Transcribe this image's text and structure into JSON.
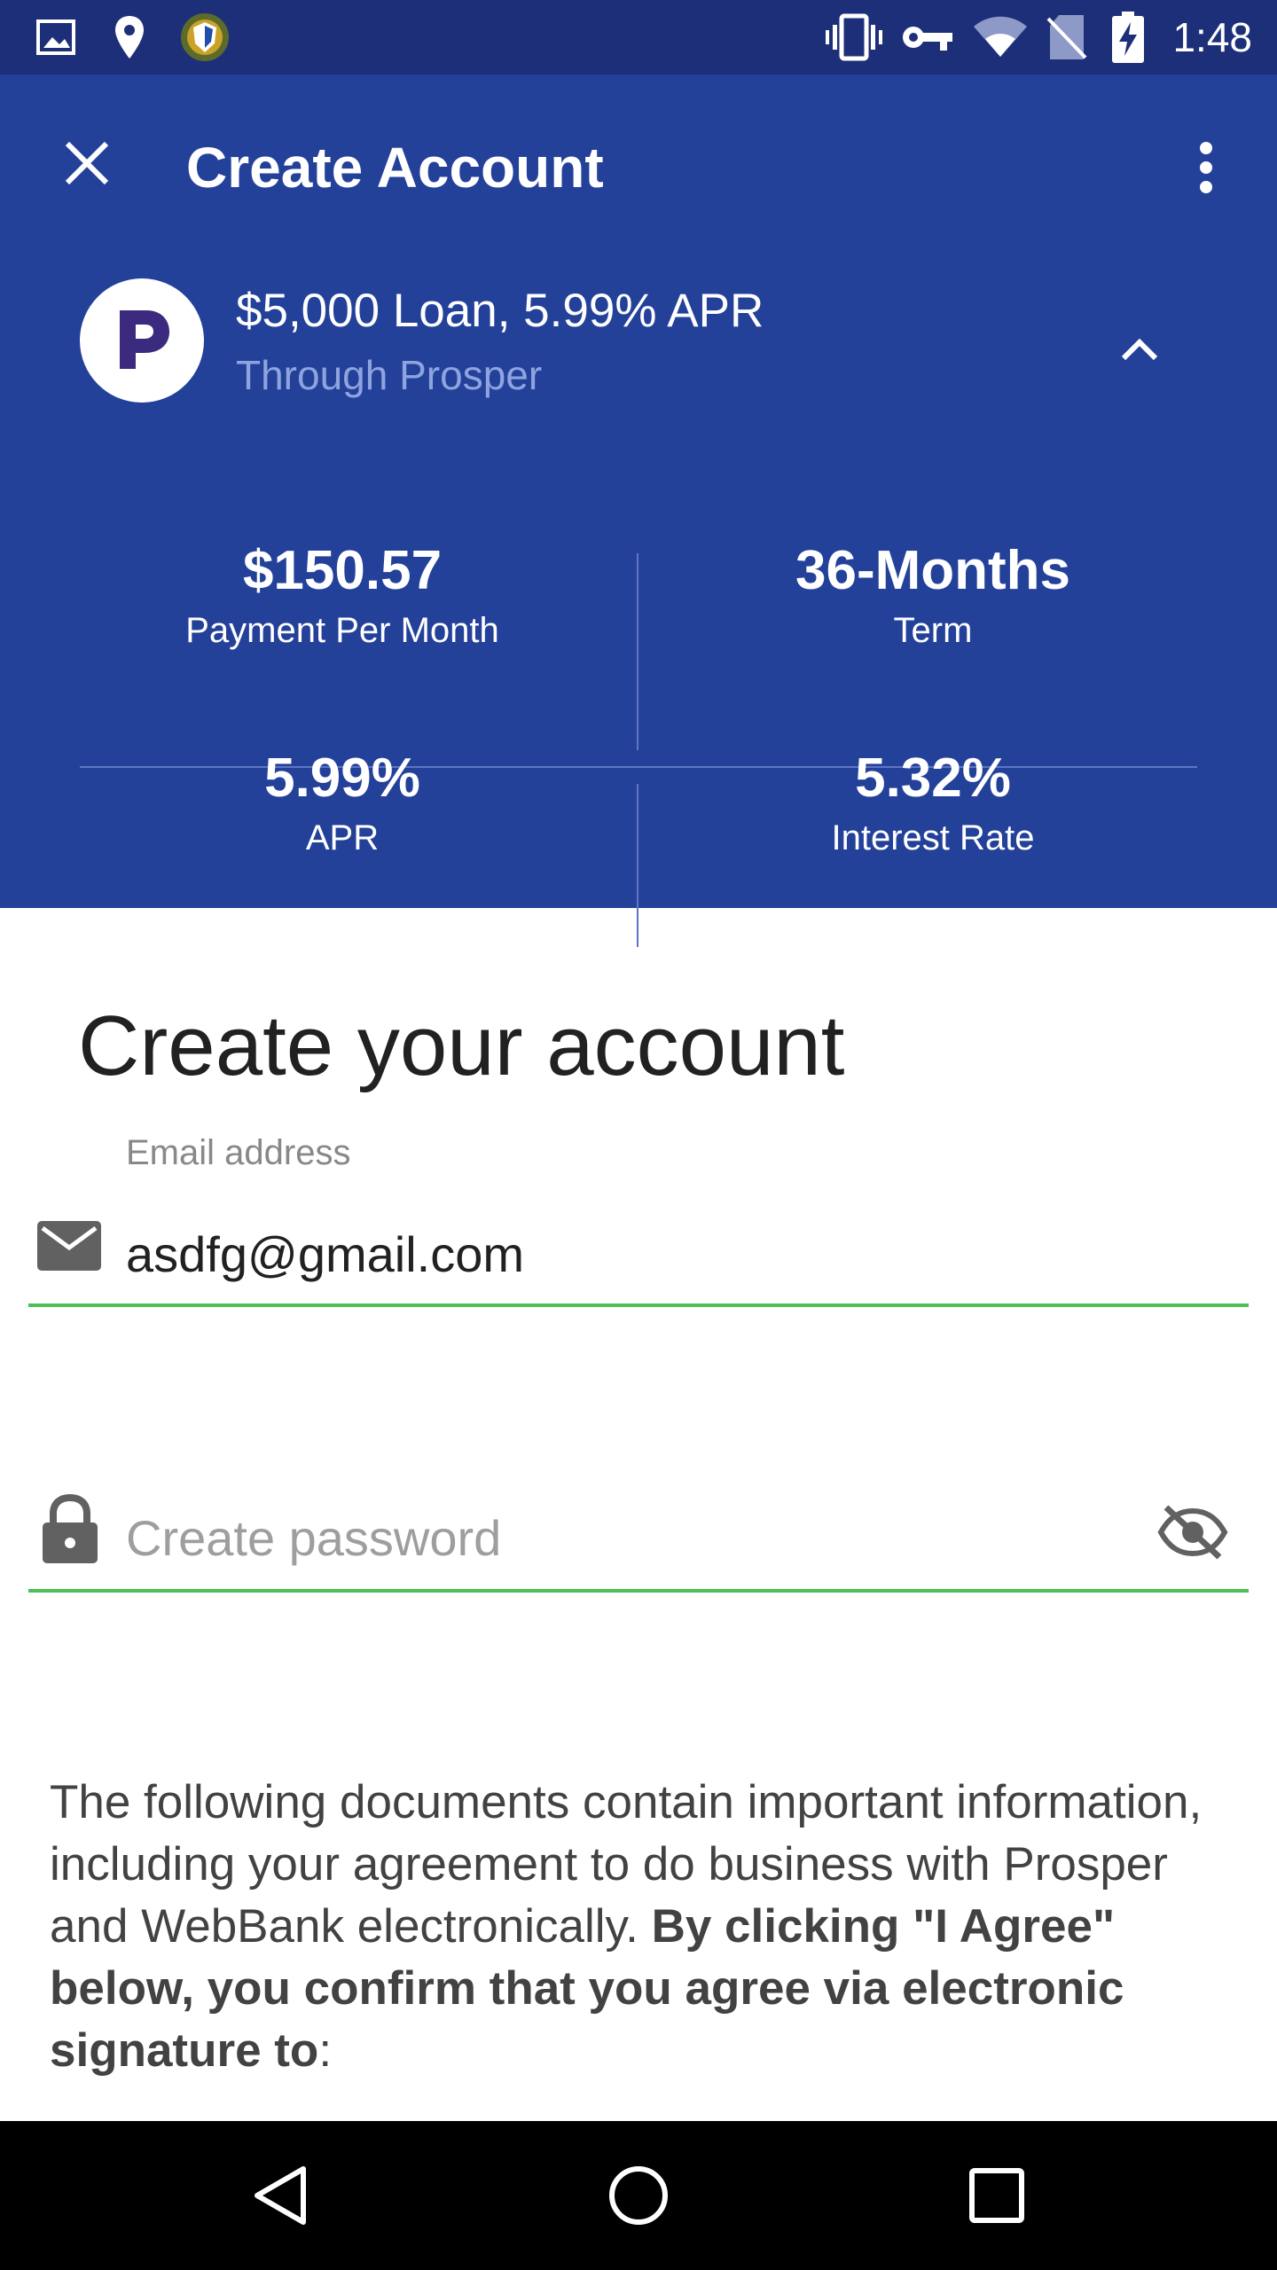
{
  "status_bar": {
    "time": "1:48",
    "icons": [
      "image-icon",
      "location-pin-icon",
      "shield-app-icon",
      "vibrate-icon",
      "vpn-key-icon",
      "wifi-icon",
      "no-sim-icon",
      "battery-charging-icon"
    ]
  },
  "app_bar": {
    "title": "Create Account",
    "close_icon": "close-icon",
    "overflow_icon": "more-vert-icon"
  },
  "loan": {
    "title": "$5,000 Loan, 5.99% APR",
    "subtitle": "Through Prosper",
    "logo_letter": "P",
    "stats": [
      {
        "value": "$150.57",
        "label": "Payment Per Month"
      },
      {
        "value": "36-Months",
        "label": "Term"
      },
      {
        "value": "5.99%",
        "label": "APR"
      },
      {
        "value": "5.32%",
        "label": "Interest Rate"
      }
    ]
  },
  "form": {
    "heading": "Create your account",
    "email_label": "Email address",
    "email_value": "asdfg@gmail.com",
    "password_placeholder": "Create password"
  },
  "agreement": {
    "plain": "The following documents contain important information, including your agreement to do business with Prosper and WebBank electronically. ",
    "bold": "By clicking \"I Agree\" below, you confirm that you agree via electronic signature to",
    "tail": ":"
  },
  "colors": {
    "status_bar": "#1e2f7a",
    "header": "#24419a",
    "accent_green": "#4cbf55",
    "logo_purple": "#3b2a7e"
  }
}
